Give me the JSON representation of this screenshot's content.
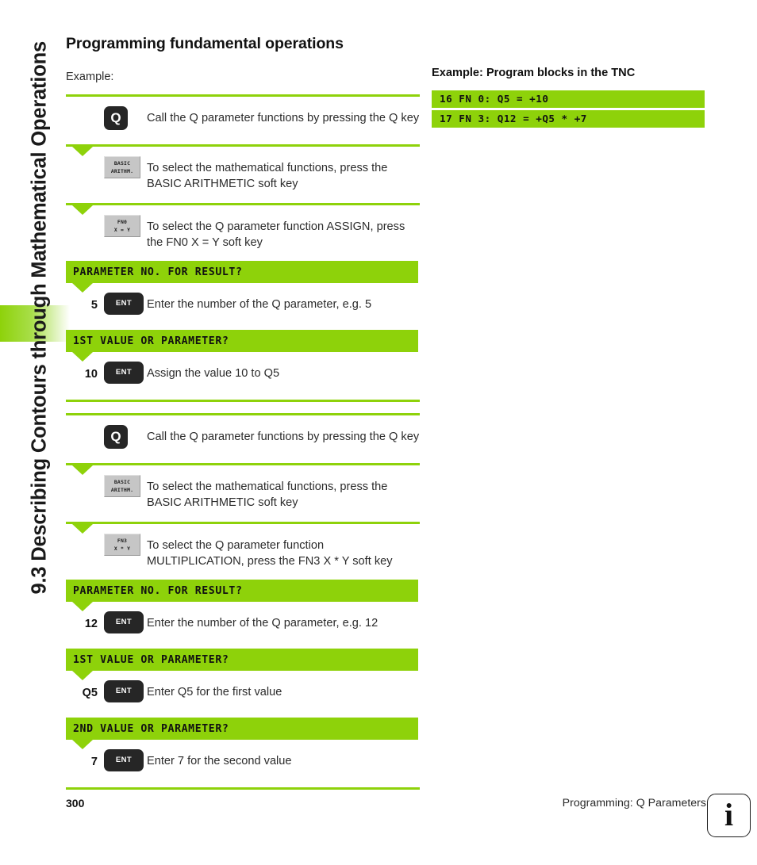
{
  "sidebar": {
    "chapter_title": "9.3 Describing Contours through Mathematical Operations",
    "accent_color": "#8ed20a"
  },
  "main": {
    "title": "Programming fundamental operations",
    "example_label": "Example:",
    "steps": [
      {
        "kind": "rule",
        "triangle": false
      },
      {
        "kind": "step",
        "gutter": "",
        "key_type": "hardkey-square",
        "key_label": "Q",
        "description": "Call the Q parameter functions by pressing the Q key"
      },
      {
        "kind": "rule",
        "triangle": true
      },
      {
        "kind": "step",
        "gutter": "",
        "key_type": "softkey",
        "key_line1": "BASIC",
        "key_line2": "ARITHM.",
        "description": "To select the mathematical functions, press the BASIC ARITHMETIC soft key"
      },
      {
        "kind": "rule",
        "triangle": true
      },
      {
        "kind": "step",
        "gutter": "",
        "key_type": "softkey",
        "key_line1": "FN0",
        "key_line2": "X = Y",
        "description": "To select the Q parameter function ASSIGN, press the FN0 X = Y soft key"
      },
      {
        "kind": "banner",
        "text": "PARAMETER NO. FOR RESULT?",
        "triangle": true
      },
      {
        "kind": "step",
        "gutter": "5",
        "key_type": "hardkey-wide",
        "key_label": "ENT",
        "description": "Enter the number of the Q parameter, e.g. 5"
      },
      {
        "kind": "banner",
        "text": "1ST VALUE OR PARAMETER?",
        "triangle": true
      },
      {
        "kind": "step",
        "gutter": "10",
        "key_type": "hardkey-wide",
        "key_label": "ENT",
        "description": "Assign the value 10 to Q5"
      },
      {
        "kind": "rule",
        "triangle": false
      },
      {
        "kind": "rule",
        "triangle": false
      },
      {
        "kind": "step",
        "gutter": "",
        "key_type": "hardkey-square",
        "key_label": "Q",
        "description": "Call the Q parameter functions by pressing the Q key"
      },
      {
        "kind": "rule",
        "triangle": true
      },
      {
        "kind": "step",
        "gutter": "",
        "key_type": "softkey",
        "key_line1": "BASIC",
        "key_line2": "ARITHM.",
        "description": "To select the mathematical functions, press the BASIC ARITHMETIC soft key"
      },
      {
        "kind": "rule",
        "triangle": true
      },
      {
        "kind": "step",
        "gutter": "",
        "key_type": "softkey",
        "key_line1": "FN3",
        "key_line2": "X * Y",
        "description": "To select the Q parameter function MULTIPLICATION, press the FN3 X * Y soft key"
      },
      {
        "kind": "banner",
        "text": "PARAMETER NO. FOR RESULT?",
        "triangle": true
      },
      {
        "kind": "step",
        "gutter": "12",
        "key_type": "hardkey-wide",
        "key_label": "ENT",
        "description": "Enter the number of the Q parameter, e.g. 12"
      },
      {
        "kind": "banner",
        "text": "1ST VALUE OR PARAMETER?",
        "triangle": true
      },
      {
        "kind": "step",
        "gutter": "Q5",
        "key_type": "hardkey-wide",
        "key_label": "ENT",
        "description": "Enter Q5 for the first value"
      },
      {
        "kind": "banner",
        "text": "2ND VALUE OR PARAMETER?",
        "triangle": true
      },
      {
        "kind": "step",
        "gutter": "7",
        "key_type": "hardkey-wide",
        "key_label": "ENT",
        "description": "Enter 7 for the second value"
      },
      {
        "kind": "rule",
        "triangle": false
      }
    ]
  },
  "code_panel": {
    "title": "Example: Program blocks in the TNC",
    "lines": [
      "16 FN 0: Q5 = +10",
      "17 FN 3: Q12 = +Q5 * +7"
    ]
  },
  "footer": {
    "page_number": "300",
    "caption": "Programming: Q Parameters",
    "info_icon_glyph": "i"
  }
}
